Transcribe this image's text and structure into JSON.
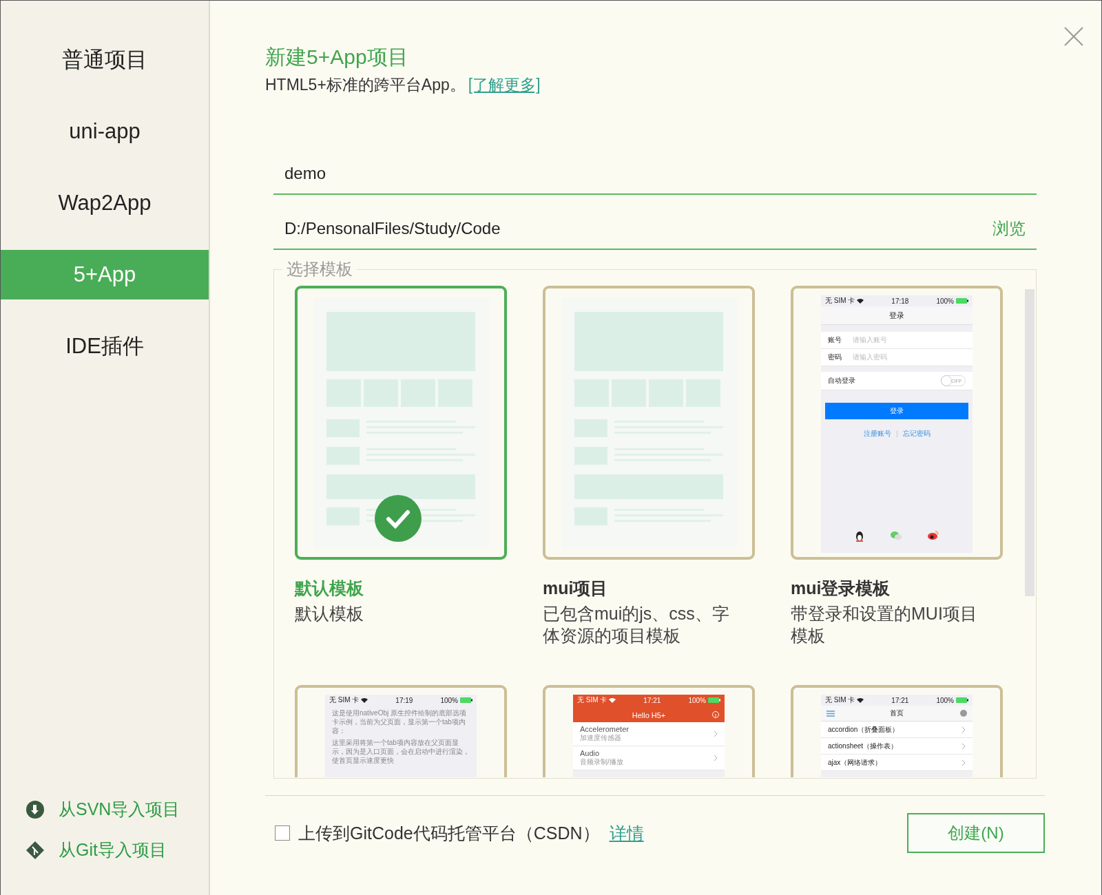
{
  "sidebar": {
    "items": [
      {
        "label": "普通项目",
        "selected": false
      },
      {
        "label": "uni-app",
        "selected": false
      },
      {
        "label": "Wap2App",
        "selected": false
      },
      {
        "label": "5+App",
        "selected": true
      },
      {
        "label": "IDE插件",
        "selected": false
      }
    ],
    "imports": [
      {
        "kind": "svn",
        "label": "从SVN导入项目"
      },
      {
        "kind": "git",
        "label": "从Git导入项目"
      }
    ]
  },
  "header": {
    "title": "新建5+App项目",
    "subtitle": "HTML5+标准的跨平台App。",
    "link": "[了解更多]"
  },
  "name_field": {
    "value": "demo"
  },
  "path_field": {
    "value": "D:/PensonalFiles/Study/Code",
    "browse": "浏览"
  },
  "templates": {
    "legend": "选择模板",
    "items": [
      {
        "kind": "wireframe",
        "title": "默认模板",
        "description": "默认模板",
        "selected": true
      },
      {
        "kind": "wireframe",
        "title": "mui项目",
        "description": "已包含mui的js、css、字体资源的项目模板",
        "selected": false
      },
      {
        "kind": "login",
        "title": "mui登录模板",
        "description": "带登录和设置的MUI项目模板",
        "selected": false,
        "preview": {
          "status": {
            "carrier": "无 SIM 卡",
            "time": "17:18",
            "battery": "100%"
          },
          "title": "登录",
          "fields": [
            {
              "label": "账号",
              "placeholder": "请输入账号"
            },
            {
              "label": "密码",
              "placeholder": "请输入密码"
            }
          ],
          "toggle": {
            "label": "自动登录",
            "on": false,
            "text": "OFF"
          },
          "button": "登录",
          "links": [
            "注册账号",
            "忘记密码"
          ]
        }
      },
      {
        "kind": "text-page",
        "selected": false,
        "preview": {
          "status": {
            "carrier": "无 SIM 卡",
            "time": "17:19",
            "battery": "100%"
          },
          "paragraphs": [
            "这是使用nativeObj 原生控件绘制的底部选项卡示例，当前为父页面，显示第一个tab项内容：",
            "这里采用将第一个tab项内容放在父页面显示，因为是入口页面，会在启动中进行渲染，使首页显示速度更快"
          ]
        }
      },
      {
        "kind": "header-list",
        "selected": false,
        "preview": {
          "status": {
            "carrier": "无 SIM 卡",
            "time": "17:21",
            "battery": "100%"
          },
          "title": "Hello H5+",
          "rows": [
            {
              "title": "Accelerometer",
              "subtitle": "加速度传感器"
            },
            {
              "title": "Audio",
              "subtitle": "音频录制/播放"
            }
          ]
        }
      },
      {
        "kind": "menu-list",
        "selected": false,
        "preview": {
          "status": {
            "carrier": "无 SIM 卡",
            "time": "17:21",
            "battery": "100%"
          },
          "title": "首页",
          "rows": [
            {
              "title": "accordion（折叠面板）"
            },
            {
              "title": "actionsheet（操作表）"
            },
            {
              "title": "ajax（网络请求）"
            }
          ]
        }
      }
    ]
  },
  "footer": {
    "upload": {
      "label": "上传到GitCode代码托管平台（CSDN）",
      "checked": false
    },
    "details_link": "详情",
    "create_button": "创建(N)"
  }
}
